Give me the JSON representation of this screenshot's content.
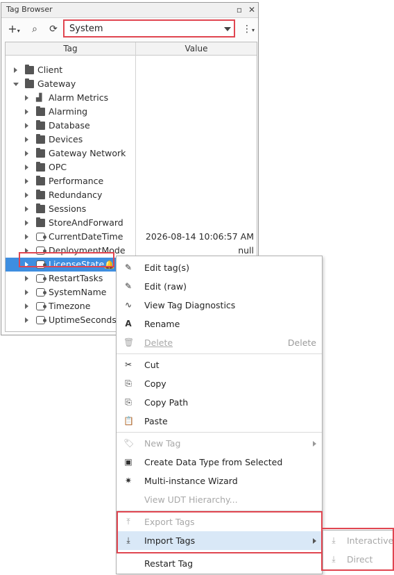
{
  "panel": {
    "title": "Tag Browser",
    "provider_value": "System",
    "columns": {
      "tag": "Tag",
      "value": "Value"
    }
  },
  "tree": {
    "client": "Client",
    "gateway": "Gateway",
    "alarm_metrics": "Alarm Metrics",
    "alarming": "Alarming",
    "database": "Database",
    "devices": "Devices",
    "gateway_network": "Gateway Network",
    "opc": "OPC",
    "performance": "Performance",
    "redundancy": "Redundancy",
    "sessions": "Sessions",
    "store_and_forward": "StoreAndForward",
    "current_date_time": "CurrentDateTime",
    "current_date_time_value": "2026-08-14 10:06:57 AM",
    "deployment_mode": "DeploymentMode",
    "deployment_mode_value": "null",
    "license_state": "LicenseState",
    "restart_tasks": "RestartTasks",
    "system_name": "SystemName",
    "timezone": "Timezone",
    "uptime_seconds": "UptimeSeconds"
  },
  "menu": {
    "edit_tags": "Edit tag(s)",
    "edit_raw": "Edit (raw)",
    "view_diagnostics": "View Tag Diagnostics",
    "rename": "Rename",
    "delete": "Delete",
    "delete_shortcut": "Delete",
    "cut": "Cut",
    "copy": "Copy",
    "copy_path": "Copy Path",
    "paste": "Paste",
    "new_tag": "New Tag",
    "create_data_type": "Create Data Type from Selected",
    "multi_instance": "Multi-instance Wizard",
    "view_udt": "View UDT Hierarchy...",
    "export_tags": "Export Tags",
    "import_tags": "Import Tags",
    "restart_tag": "Restart Tag"
  },
  "submenu": {
    "interactive": "Interactive",
    "direct": "Direct"
  },
  "colors": {
    "selection": "#3e8ee0",
    "highlight_box": "#e04550",
    "menu_hover": "#d9e8f7"
  }
}
